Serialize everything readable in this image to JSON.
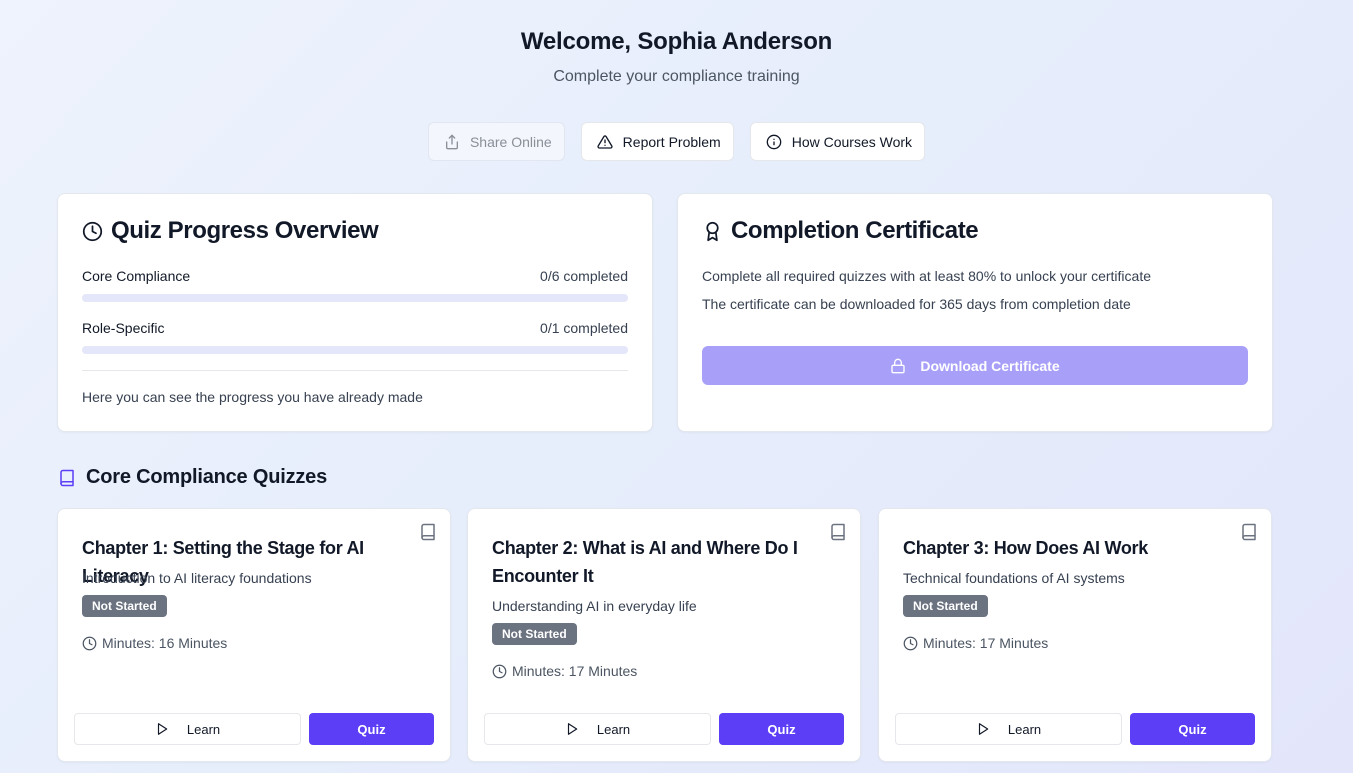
{
  "header": {
    "title": "Welcome, Sophia Anderson",
    "subtitle": "Complete your compliance training"
  },
  "toolbar": {
    "share_label": "Share Online",
    "report_label": "Report Problem",
    "how_label": "How Courses Work"
  },
  "progress": {
    "title": "Quiz Progress Overview",
    "rows": [
      {
        "label": "Core Compliance",
        "value": "0/6 completed",
        "fraction": 0
      },
      {
        "label": "Role-Specific",
        "value": "0/1 completed",
        "fraction": 0
      }
    ],
    "note": "Here you can see the progress you have already made"
  },
  "certificate": {
    "title": "Completion Certificate",
    "line1": "Complete all required quizzes with at least 80% to unlock your certificate",
    "line2": "The certificate can be downloaded for 365 days from completion date",
    "button_label": "Download Certificate"
  },
  "section": {
    "title": "Core Compliance Quizzes"
  },
  "quizzes": [
    {
      "title": "Chapter 1: Setting the Stage for AI Literacy",
      "description": "Introduction to AI literacy foundations",
      "status": "Not Started",
      "minutes": "Minutes: 16 Minutes",
      "learn_label": "Learn",
      "quiz_label": "Quiz"
    },
    {
      "title": "Chapter 2: What is AI and Where Do I Encounter It",
      "description": "Understanding AI in everyday life",
      "status": "Not Started",
      "minutes": "Minutes: 17 Minutes",
      "learn_label": "Learn",
      "quiz_label": "Quiz"
    },
    {
      "title": "Chapter 3: How Does AI Work",
      "description": "Technical foundations of AI systems",
      "status": "Not Started",
      "minutes": "Minutes: 17 Minutes",
      "learn_label": "Learn",
      "quiz_label": "Quiz"
    }
  ],
  "icons": {
    "share": "share-icon",
    "report": "warning-triangle-icon",
    "how": "info-icon",
    "progress": "clock-icon",
    "certificate": "award-icon",
    "lock": "lock-icon",
    "section": "book-icon",
    "play": "play-icon"
  },
  "colors": {
    "accent": "#5b3ef5",
    "accent_disabled": "#a8a0f8",
    "badge": "#6b7280"
  }
}
